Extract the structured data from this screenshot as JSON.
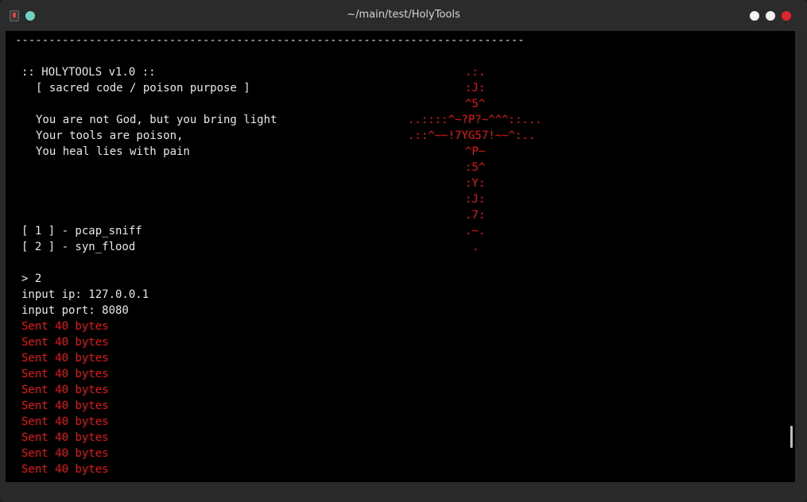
{
  "window": {
    "title": "~/main/test/HolyTools"
  },
  "terminal": {
    "separator": "----------------------------------------------------------------------------",
    "banner_title": ":: HOLYTOOLS v1.0 ::",
    "banner_subtitle": "[ sacred code / poison purpose ]",
    "verse": [
      "You are not God, but you bring light",
      "Your tools are poison,",
      "You heal lies with pain"
    ],
    "cross_art": [
      ".:.",
      ":J:",
      "^5^",
      "..::::^~?P?~^^^::...",
      ".::^~~!7YG57!~~^:..",
      "^P~",
      ":5^",
      ":Y:",
      ":J:",
      ".7:",
      ".~.",
      "."
    ],
    "menu": [
      "[ 1 ] - pcap_sniff",
      "[ 2 ] - syn_flood"
    ],
    "prompt_input": "> 2",
    "ip_prompt": "input ip: 127.0.0.1",
    "port_prompt": "input port: 8080",
    "sent_lines": [
      "Sent 40 bytes",
      "Sent 40 bytes",
      "Sent 40 bytes",
      "Sent 40 bytes",
      "Sent 40 bytes",
      "Sent 40 bytes",
      "Sent 40 bytes",
      "Sent 40 bytes",
      "Sent 40 bytes",
      "Sent 40 bytes"
    ]
  },
  "colors": {
    "terminal_background": "#000000",
    "text": "#e8e8e8",
    "accent_red": "#e81414",
    "close_button": "#e0252b"
  }
}
